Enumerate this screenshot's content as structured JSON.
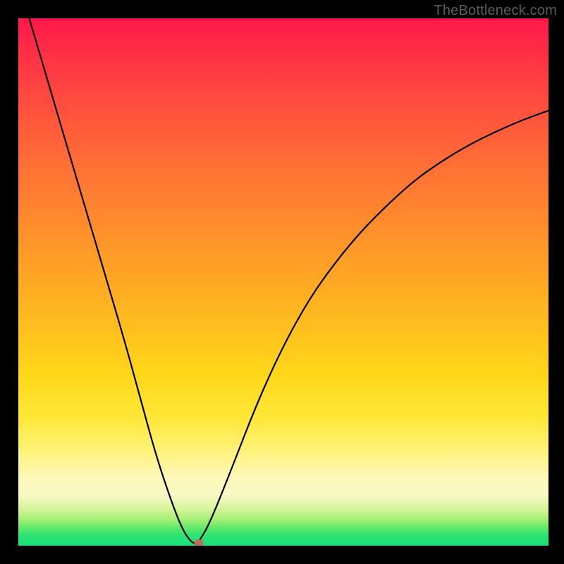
{
  "watermark": "TheBottleneck.com",
  "colors": {
    "frame": "#000000",
    "curve": "#000000",
    "marker": "#bd6a60"
  },
  "chart_data": {
    "type": "line",
    "title": "",
    "xlabel": "",
    "ylabel": "",
    "xlim": [
      0,
      100
    ],
    "ylim": [
      0,
      100
    ],
    "grid": false,
    "legend": false,
    "series": [
      {
        "name": "bottleneck-curve",
        "x": [
          0,
          5,
          10,
          15,
          20,
          23,
          26,
          29,
          31,
          32.5,
          33.5,
          34,
          36,
          40,
          45,
          50,
          55,
          60,
          65,
          70,
          75,
          80,
          85,
          90,
          95,
          100
        ],
        "y": [
          107,
          90,
          73,
          56,
          39,
          28,
          17,
          8,
          3,
          0.8,
          0.3,
          0.7,
          4,
          14,
          27,
          38,
          47,
          54,
          60,
          65,
          69.5,
          73,
          76,
          78.5,
          80.7,
          82.5
        ]
      }
    ],
    "marker": {
      "x": 34,
      "y": 0.5
    },
    "background_gradient": {
      "stops": [
        {
          "pos": 0.0,
          "color": "#ff184a"
        },
        {
          "pos": 0.5,
          "color": "#ffa824"
        },
        {
          "pos": 0.76,
          "color": "#ffe83a"
        },
        {
          "pos": 0.9,
          "color": "#f6f8c4"
        },
        {
          "pos": 1.0,
          "color": "#17e07c"
        }
      ]
    }
  }
}
